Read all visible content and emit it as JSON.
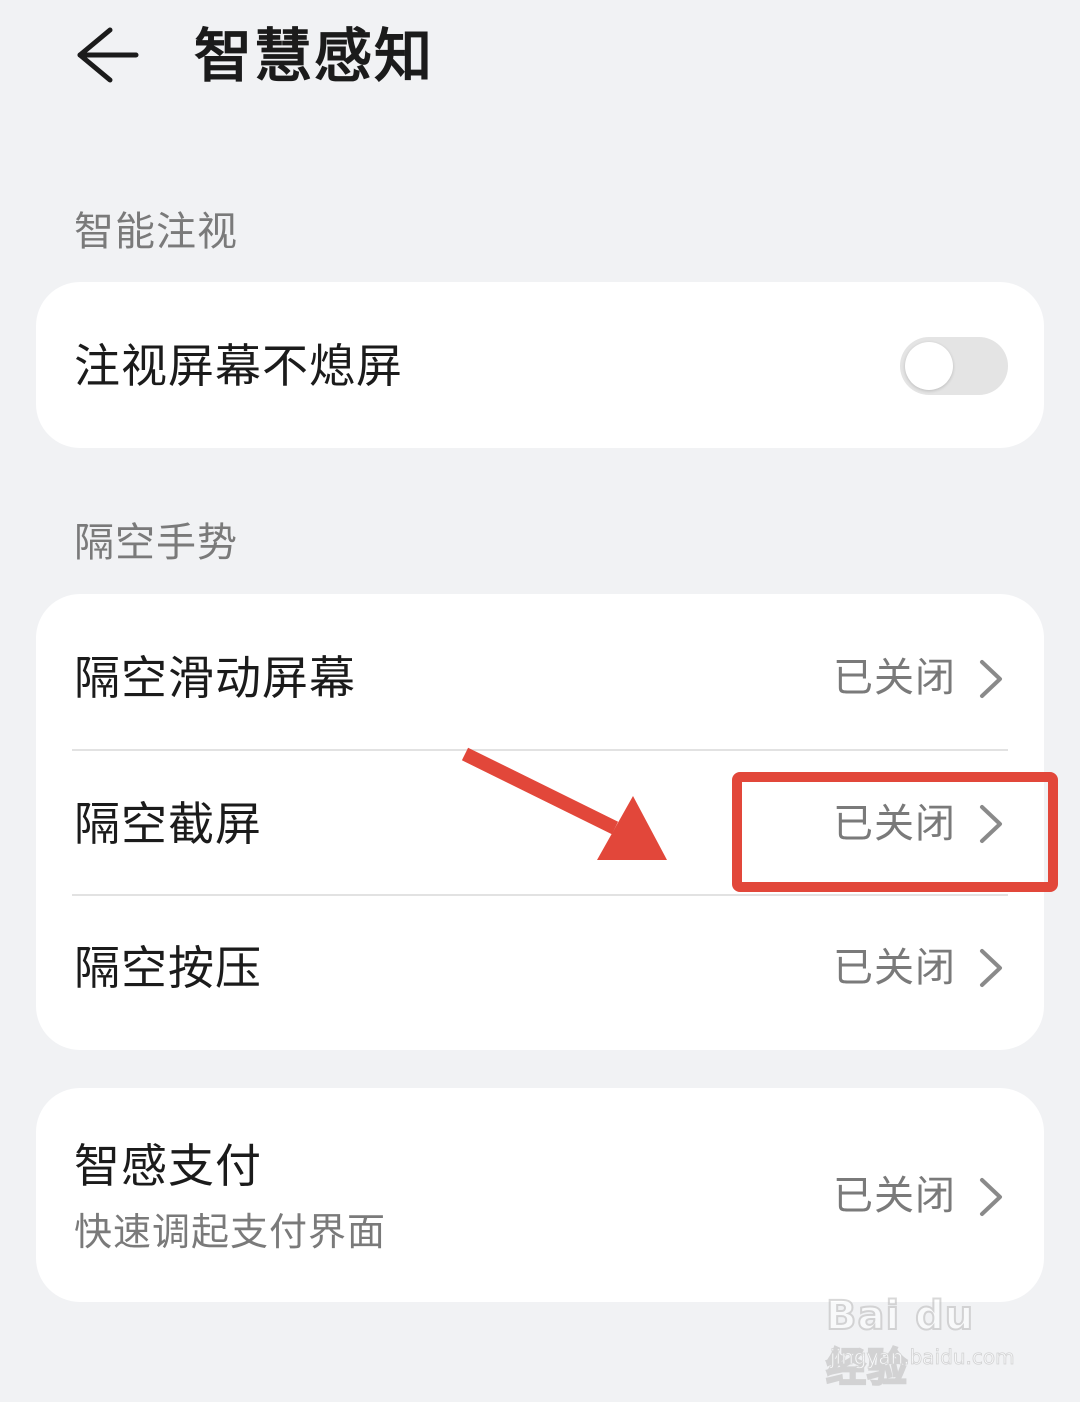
{
  "header": {
    "title": "智慧感知",
    "back_icon": "arrow-left-icon"
  },
  "sections": {
    "smart_gaze": {
      "label": "智能注视",
      "items": [
        {
          "title": "注视屏幕不熄屏",
          "control": "toggle",
          "on": false
        }
      ]
    },
    "air_gesture": {
      "label": "隔空手势",
      "items": [
        {
          "title": "隔空滑动屏幕",
          "value": "已关闭"
        },
        {
          "title": "隔空截屏",
          "value": "已关闭"
        },
        {
          "title": "隔空按压",
          "value": "已关闭"
        }
      ]
    },
    "smart_pay": {
      "items": [
        {
          "title": "智感支付",
          "subtitle": "快速调起支付界面",
          "value": "已关闭"
        }
      ]
    }
  },
  "annotation": {
    "highlight_color": "#e2473a",
    "arrow_color": "#e2473a"
  },
  "watermark": {
    "logo": "Bai du 经验",
    "url": "jingyan.baidu.com"
  },
  "colors": {
    "background": "#f1f2f4",
    "card": "#ffffff",
    "primary_text": "#1b1b1b",
    "secondary_text": "#7a7a7a",
    "toggle_off_track": "#e4e4e4"
  }
}
